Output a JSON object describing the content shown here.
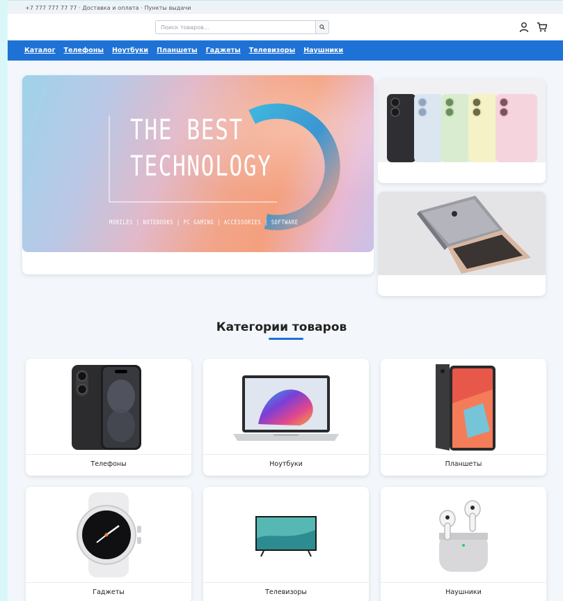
{
  "topbar": {
    "text": "+7 777 777 77 77 · Доставка и оплата · Пункты выдачи"
  },
  "header": {
    "search_placeholder": "Поиск товаров...",
    "icons": [
      "search-icon",
      "user-icon",
      "cart-icon"
    ]
  },
  "nav": {
    "items": [
      "Каталог",
      "Телефоны",
      "Ноутбуки",
      "Планшеты",
      "Гаджеты",
      "Телевизоры",
      "Наушники"
    ]
  },
  "hero": {
    "title_line1": "THE BEST",
    "title_line2": "TECHNOLOGY",
    "subtitle": "MOBILES | NOTEBOOKS | PC GAMING | ACCESSORIES | SOFTWARE"
  },
  "promos": [
    {
      "image": "colorful-phones"
    },
    {
      "image": "laptops"
    }
  ],
  "categories": {
    "title": "Категории товаров",
    "items": [
      {
        "label": "Телефоны",
        "image": "phone"
      },
      {
        "label": "Ноутбуки",
        "image": "laptop"
      },
      {
        "label": "Планшеты",
        "image": "tablet"
      },
      {
        "label": "Гаджеты",
        "image": "smartwatch"
      },
      {
        "label": "Телевизоры",
        "image": "tv"
      },
      {
        "label": "Наушники",
        "image": "earbuds"
      }
    ]
  },
  "colors": {
    "accent": "#1e72d6",
    "background": "#f3f6fb"
  }
}
